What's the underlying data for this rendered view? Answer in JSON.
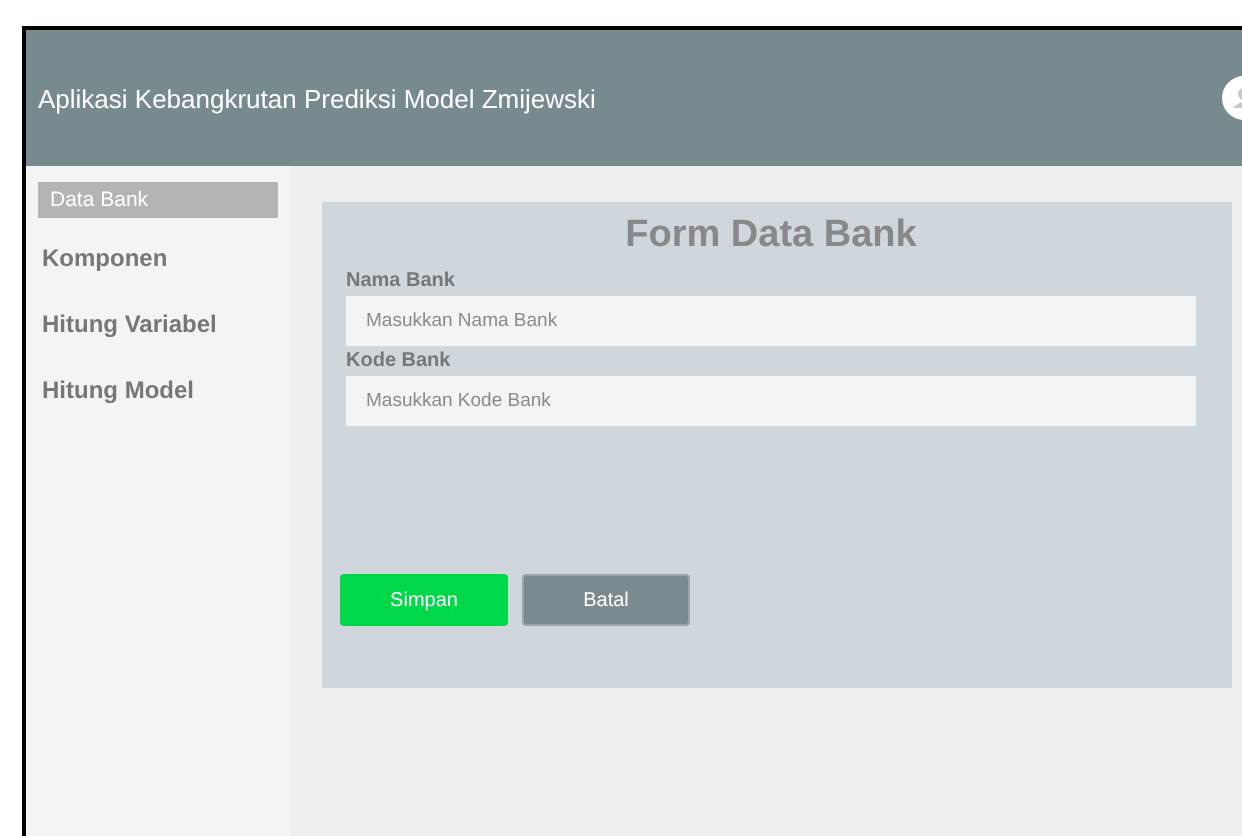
{
  "header": {
    "title": "Aplikasi Kebangkrutan Prediksi Model Zmijewski"
  },
  "sidebar": {
    "items": [
      {
        "label": "Data Bank",
        "selected": true
      },
      {
        "label": "Komponen",
        "selected": false
      },
      {
        "label": "Hitung Variabel",
        "selected": false
      },
      {
        "label": "Hitung Model",
        "selected": false
      }
    ]
  },
  "form": {
    "title": "Form Data Bank",
    "fields": [
      {
        "label": "Nama Bank",
        "placeholder": "Masukkan Nama Bank"
      },
      {
        "label": "Kode Bank",
        "placeholder": "Masukkan Kode Bank"
      }
    ],
    "buttons": [
      {
        "label": "Simpan",
        "kind": "primary"
      },
      {
        "label": "Batal",
        "kind": "secondary"
      }
    ]
  }
}
